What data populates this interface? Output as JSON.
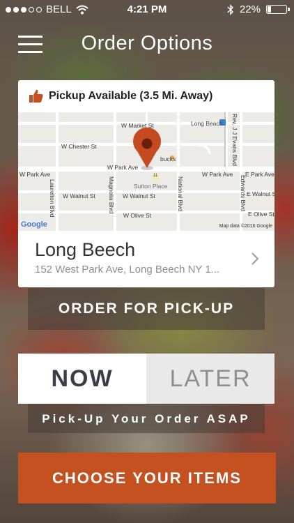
{
  "status_bar": {
    "carrier": "BELL",
    "time": "4:21 PM",
    "battery": "22%",
    "battery_level": 0.22
  },
  "nav": {
    "title": "Order Options"
  },
  "location_card": {
    "pickup_text": "Pickup Available (3.5 Mi. Away)",
    "location_name": "Long Beech",
    "address": "152 West Park Ave, Long Beech NY 1...",
    "map": {
      "streets": {
        "w_market_st": "W Market St",
        "w_chester_st": "W Chester St",
        "w_park_ave": "W Park Ave",
        "w_park_ave_left": "W Park Ave",
        "w_park_ave_right": "W Park Ave",
        "e_park_ave": "E Park Ave",
        "w_walnut_st_left": "W Walnut St",
        "w_walnut_st_mid": "W Walnut St",
        "e_walnut_st": "E Walnut St",
        "w_olive_st": "W Olive St",
        "e_olive_st": "E Olive St",
        "laurelton_blvd": "Laurelton Blvd",
        "magnolia_blvd": "Magnolia Blvd",
        "national_blvd": "National Blvd",
        "edwards_blvd": "Edwards Blvd",
        "rev_jj_evans_blvd": "Rev. J J Evans Blvd",
        "long_beach": "Long Beach",
        "sutton_place": "Sutton Place",
        "starbucks_fragment": "bucks",
        "route_11": "11"
      },
      "google_logo": "Google",
      "attribution": "Map data ©2016 Google"
    }
  },
  "buttons": {
    "order_pickup": "ORDER FOR PICK-UP",
    "now": "NOW",
    "later": "LATER",
    "asap": "Pick-Up Your Order ASAP",
    "choose_items": "CHOOSE YOUR ITEMS"
  },
  "colors": {
    "accent_orange": "#c4511f",
    "marker_red": "#c54a1f",
    "text_dark": "#3a3f47"
  }
}
